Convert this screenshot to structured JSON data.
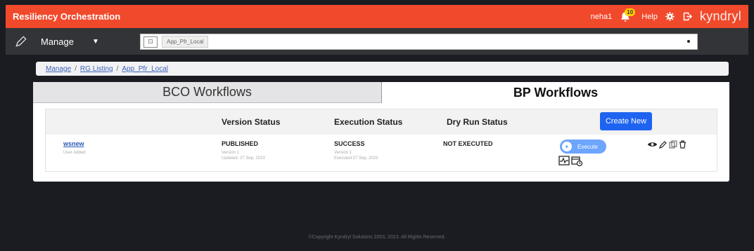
{
  "header": {
    "app_title": "Resiliency Orchestration",
    "user": "neha1",
    "notifications_count": "10",
    "help": "Help",
    "brand": "kyndryl"
  },
  "subbar": {
    "manage_label": "Manage",
    "context_value": "App_Pfr_Local"
  },
  "breadcrumb": [
    "Manage",
    "RG Listing",
    "App_Pfr_Local"
  ],
  "tabs": {
    "bco": "BCO Workflows",
    "bp": "BP Workflows"
  },
  "table": {
    "headers": {
      "version": "Version Status",
      "execution": "Execution Status",
      "dry_run": "Dry Run Status"
    },
    "create_label": "Create New",
    "rows": [
      {
        "name": "wsnew",
        "added_by": "User Added",
        "version_status": "PUBLISHED",
        "version": "Version 1",
        "updated": "Updated: 27 Sep, 2023",
        "execution_status": "SUCCESS",
        "exec_version": "Version 1",
        "executed": "Executed:27 Sep, 2023",
        "dry_run_status": "NOT EXECUTED",
        "execute_label": "Execute"
      }
    ]
  },
  "footer": "©Copyright Kyndryl Solutions 2003, 2023. All Rights Reserved.",
  "colors": {
    "topbar": "#f1492b",
    "subbar": "#333438",
    "primary_button": "#1e64f0",
    "execute_button": "#6da5ff",
    "success": "#3fae5a"
  }
}
